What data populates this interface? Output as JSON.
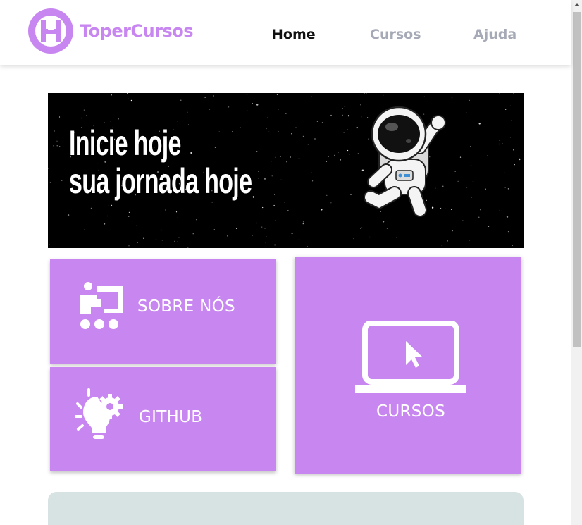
{
  "brand": {
    "name": "ToperCursos",
    "color": "#c886f0"
  },
  "nav": {
    "items": [
      {
        "label": "Home",
        "active": true
      },
      {
        "label": "Cursos",
        "active": false
      },
      {
        "label": "Ajuda",
        "active": false
      }
    ]
  },
  "hero": {
    "line1": "Inicie hoje",
    "line2": "sua jornada hoje",
    "image": "astronaut-illustration"
  },
  "cards": {
    "about": {
      "label": "SOBRE NÓS",
      "icon": "presentation-icon"
    },
    "github": {
      "label": "GITHUB",
      "icon": "idea-gear-icon"
    },
    "cursos": {
      "label": "CURSOS",
      "icon": "laptop-cursor-icon"
    }
  },
  "colors": {
    "card_bg": "#c886f0",
    "nav_active": "#111111",
    "nav_inactive": "#a6a9b6",
    "hero_bg": "#000000",
    "panel_bg": "#d7e3e2"
  }
}
